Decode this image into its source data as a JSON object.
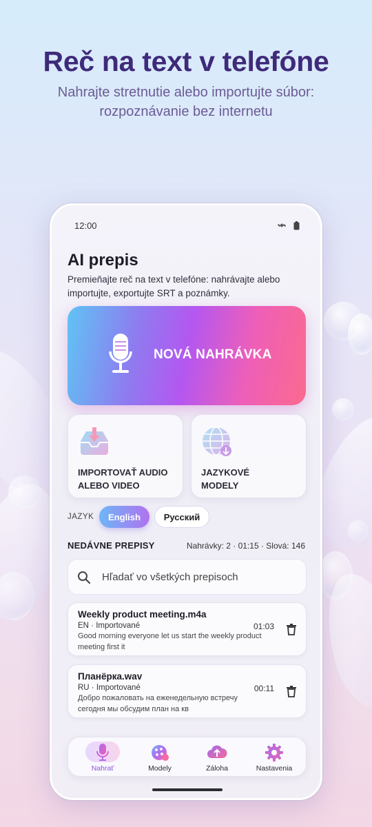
{
  "hero": {
    "title": "Reč na text v telefóne",
    "subtitle_line1": "Nahrajte stretnutie alebo importujte súbor:",
    "subtitle_line2": "rozpoznávanie bez internetu"
  },
  "status_bar": {
    "time": "12:00"
  },
  "app": {
    "title": "AI prepis",
    "description": "Premieňajte reč na text v telefóne: nahrávajte alebo importujte, exportujte SRT a poznámky."
  },
  "record_button": {
    "label": "NOVÁ NAHRÁVKA",
    "icon": "microphone-icon"
  },
  "tiles": [
    {
      "label_line1": "IMPORTOVAŤ AUDIO",
      "label_line2": "ALEBO VIDEO",
      "icon": "import-tray-icon"
    },
    {
      "label_line1": "JAZYKOVÉ",
      "label_line2": "MODELY",
      "icon": "globe-download-icon"
    }
  ],
  "language": {
    "label": "JAZYK",
    "options": [
      "English",
      "Русский"
    ],
    "selected": "English"
  },
  "recent": {
    "title": "NEDÁVNE PREPISY",
    "stats": "Nahrávky: 2 · 01:15 · Slová: 146"
  },
  "search": {
    "placeholder": "Hľadať vo všetkých prepisoch"
  },
  "recordings": [
    {
      "name": "Weekly product meeting.m4a",
      "meta": "EN · Importované",
      "duration": "01:03",
      "snippet": "Good morning everyone let us start the weekly product meeting first it"
    },
    {
      "name": "Планёрка.wav",
      "meta": "RU · Importované",
      "duration": "00:11",
      "snippet": "Добро пожаловать на еженедельную встречу сегодня мы обсудим план на кв"
    }
  ],
  "bottom_nav": [
    {
      "label": "Nahrať",
      "icon": "microphone-icon",
      "active": true
    },
    {
      "label": "Modely",
      "icon": "models-icon",
      "active": false
    },
    {
      "label": "Záloha",
      "icon": "cloud-upload-icon",
      "active": false
    },
    {
      "label": "Nastavenia",
      "icon": "gear-icon",
      "active": false
    }
  ],
  "colors": {
    "hero_title": "#3f2a7a",
    "accent_purple": "#b457f0",
    "accent_pink": "#fb6a8e",
    "accent_blue": "#5fc4f4"
  }
}
